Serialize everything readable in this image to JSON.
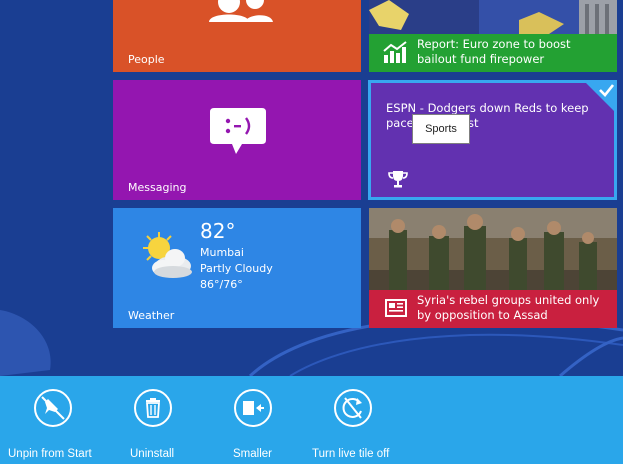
{
  "colors": {
    "background": "#1a3e92",
    "people_tile": "#d95228",
    "news_tile": "#23a133",
    "messaging_tile": "#9416b0",
    "sports_tile": "#6231b0",
    "weather_tile": "#2e86e5",
    "photo_news_strip": "#c9203f",
    "selection": "#38a7f0",
    "app_bar": "#2aa6ea"
  },
  "tiles": {
    "people": {
      "label": "People",
      "icon": "people-icon"
    },
    "news": {
      "headline": "Report: Euro zone to boost bailout fund firepower",
      "icon": "chart-icon"
    },
    "messaging": {
      "label": "Messaging",
      "icon": "chat-smiley-icon"
    },
    "sports": {
      "headline": "ESPN - Dodgers down Reds to keep pace in NL West",
      "icon": "trophy-icon",
      "selected": true
    },
    "weather": {
      "label": "Weather",
      "temperature": "82°",
      "city": "Mumbai",
      "condition": "Partly Cloudy",
      "range": "86°/76°",
      "icon": "sun-cloud-icon"
    },
    "photo_news": {
      "headline": "Syria's rebel groups united only by opposition to Assad",
      "icon": "news-icon"
    }
  },
  "tooltip": {
    "text": "Sports"
  },
  "app_bar": {
    "unpin": {
      "label": "Unpin from Start",
      "icon": "unpin-icon"
    },
    "uninstall": {
      "label": "Uninstall",
      "icon": "trash-icon"
    },
    "smaller": {
      "label": "Smaller",
      "icon": "resize-smaller-icon"
    },
    "live_tile": {
      "label": "Turn live tile off",
      "icon": "live-tile-off-icon"
    }
  }
}
